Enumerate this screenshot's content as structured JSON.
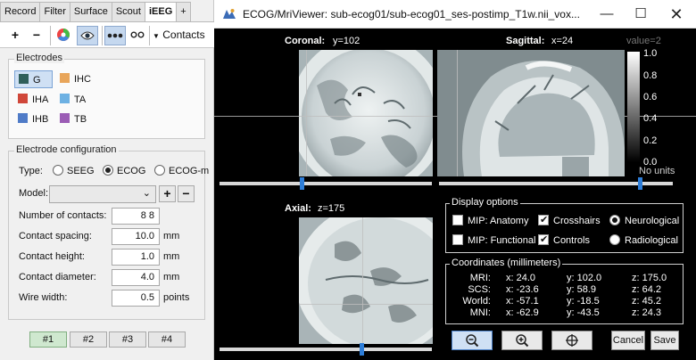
{
  "tabs": [
    "Record",
    "Filter",
    "Surface",
    "Scout",
    "iEEG",
    "+"
  ],
  "toolbar": {
    "contacts_label": "Contacts"
  },
  "electrodes": {
    "title": "Electrodes",
    "items": [
      {
        "label": "G",
        "color": "#2f5f5a"
      },
      {
        "label": "IHC",
        "color": "#e8a55a"
      },
      {
        "label": "IHA",
        "color": "#d0473a"
      },
      {
        "label": "TA",
        "color": "#6db1e3"
      },
      {
        "label": "IHB",
        "color": "#4f7bc7"
      },
      {
        "label": "TB",
        "color": "#9b5db5"
      }
    ]
  },
  "config": {
    "title": "Electrode configuration",
    "type_label": "Type:",
    "type_options": [
      "SEEG",
      "ECOG",
      "ECOG-m"
    ],
    "type_selected": "ECOG",
    "model_label": "Model:",
    "model_value": "",
    "fields": [
      {
        "label": "Number of contacts:",
        "value": "8 8",
        "unit": ""
      },
      {
        "label": "Contact spacing:",
        "value": "10.0",
        "unit": "mm"
      },
      {
        "label": "Contact height:",
        "value": "1.0",
        "unit": "mm"
      },
      {
        "label": "Contact diameter:",
        "value": "4.0",
        "unit": "mm"
      },
      {
        "label": "Wire width:",
        "value": "0.5",
        "unit": "points"
      }
    ],
    "pages": [
      "#1",
      "#2",
      "#3",
      "#4"
    ]
  },
  "viewer": {
    "title": "ECOG/MriViewer: sub-ecog01/sub-ecog01_ses-postimp_T1w.nii_vox...",
    "coronal_label": "Coronal:",
    "coronal_value": "y=102",
    "sagittal_label": "Sagittal:",
    "sagittal_value": "x=24",
    "axial_label": "Axial:",
    "axial_value": "z=175",
    "value_readout": "value=2",
    "colorbar_ticks": [
      "1.0",
      "0.8",
      "0.6",
      "0.4",
      "0.2",
      "0.0"
    ],
    "colorbar_units": "No units",
    "display_options": {
      "title": "Display options",
      "mip_anatomy": "MIP: Anatomy",
      "mip_functional": "MIP: Functional",
      "crosshairs": "Crosshairs",
      "controls": "Controls",
      "neurological": "Neurological",
      "radiological": "Radiological"
    },
    "coordinates": {
      "title": "Coordinates (millimeters)",
      "rows": [
        {
          "name": "MRI:",
          "x": "x: 24.0",
          "y": "y: 102.0",
          "z": "z: 175.0"
        },
        {
          "name": "SCS:",
          "x": "x: -23.6",
          "y": "y: 58.9",
          "z": "z: 64.2"
        },
        {
          "name": "World:",
          "x": "x: -57.1",
          "y": "y: -18.5",
          "z": "z: 45.2"
        },
        {
          "name": "MNI:",
          "x": "x: -62.9",
          "y": "y: -43.5",
          "z": "z: 24.3"
        }
      ]
    },
    "cancel_label": "Cancel",
    "save_label": "Save"
  }
}
